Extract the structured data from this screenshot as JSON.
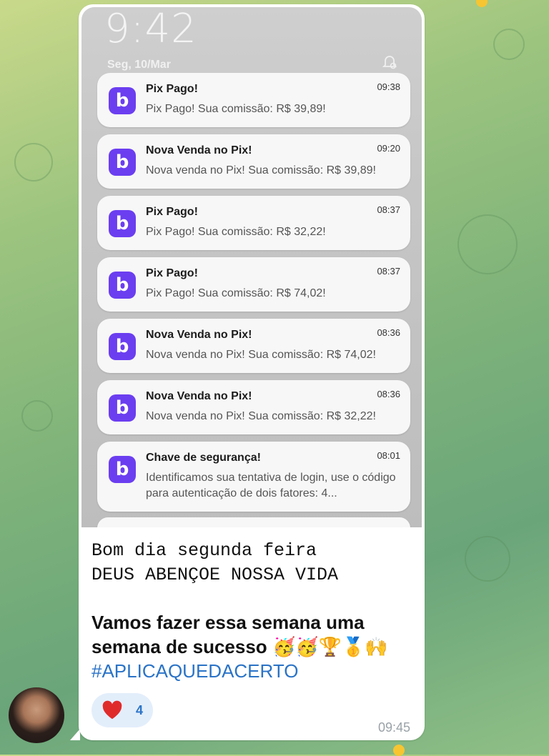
{
  "lockscreen": {
    "time": "9:42",
    "date": "Seg, 10/Mar",
    "app_icon_letter": "b",
    "app_icon_color": "#6b3ef0"
  },
  "notifications": [
    {
      "title": "Pix Pago!",
      "time": "09:38",
      "body": "Pix Pago! Sua comissão: R$ 39,89!"
    },
    {
      "title": "Nova Venda no Pix!",
      "time": "09:20",
      "body": "Nova venda no Pix! Sua comissão: R$ 39,89!"
    },
    {
      "title": "Pix Pago!",
      "time": "08:37",
      "body": "Pix Pago! Sua comissão: R$ 32,22!"
    },
    {
      "title": "Pix Pago!",
      "time": "08:37",
      "body": "Pix Pago! Sua comissão: R$ 74,02!"
    },
    {
      "title": "Nova Venda no Pix!",
      "time": "08:36",
      "body": "Nova venda no Pix! Sua comissão: R$ 74,02!"
    },
    {
      "title": "Nova Venda no Pix!",
      "time": "08:36",
      "body": "Nova venda no Pix! Sua comissão: R$ 32,22!"
    },
    {
      "title": "Chave de segurança!",
      "time": "08:01",
      "body": "Identificamos sua tentativa de login, use o código para autenticação de dois fatores: 4..."
    }
  ],
  "message": {
    "mono_text": "Bom dia segunda feira\nDEUS ABENÇOE NOSSA VIDA",
    "bold_text": "Vamos fazer essa semana uma semana de sucesso",
    "emojis": "🥳🥳🏆🥇🙌",
    "hashtag": "#APLICAQUEDACERTO",
    "time": "09:45"
  },
  "reaction": {
    "emoji": "heart",
    "count": "4"
  },
  "colors": {
    "accent_link": "#2a73c7",
    "reaction_bg": "#e3eefb",
    "heart": "#e02b2b"
  }
}
